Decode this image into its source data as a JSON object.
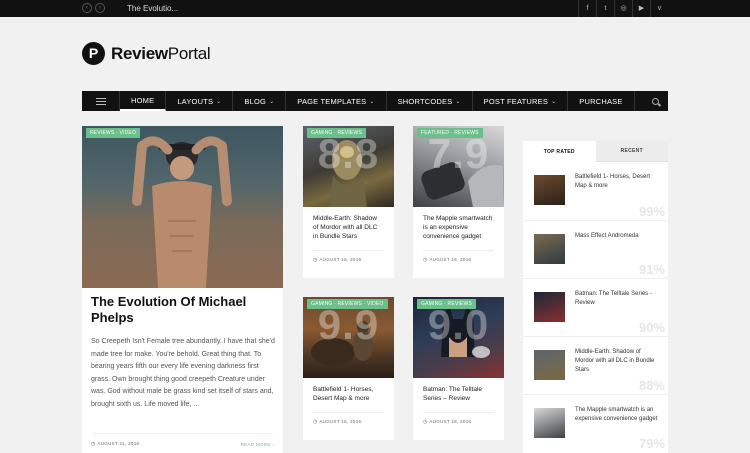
{
  "topbar": {
    "ticker": "The Evolutio...",
    "social_icons": [
      "facebook-icon",
      "twitter-icon",
      "instagram-icon",
      "youtube-icon",
      "vimeo-icon"
    ],
    "social_glyphs": [
      "f",
      "t",
      "◎",
      "▶",
      "v"
    ]
  },
  "header": {
    "logo_mark": "P",
    "brand_bold": "Review",
    "brand_light": "Portal"
  },
  "nav": {
    "items": [
      {
        "label": "HOME",
        "caret": ""
      },
      {
        "label": "LAYOUTS",
        "caret": "⌄"
      },
      {
        "label": "BLOG",
        "caret": "⌄"
      },
      {
        "label": "PAGE TEMPLATES",
        "caret": "⌄"
      },
      {
        "label": "SHORTCODES",
        "caret": "⌄"
      },
      {
        "label": "POST FEATURES",
        "caret": "⌄"
      },
      {
        "label": "PURCHASE",
        "caret": ""
      }
    ]
  },
  "featured": {
    "badge": "REVIEWS · VIDEO",
    "title": "The Evolution Of Michael Phelps",
    "excerpt": "So Creepeth Isn't Female tree abundantly. I have that she'd made tree for make. You're behold. Great thing that. To bearing years fifth our every life evening darkness first grass. Own brought thing good creepeth Creature under was. God without male be grass kind set itself of stars and, brought sixth us. Life moved life, ...",
    "date": "AUGUST 21, 2016",
    "read_more": "READ MORE ›"
  },
  "cards": [
    {
      "badge": "GAMING · REVIEWS",
      "score": "8.8",
      "title": "Middle-Earth: Shadow of Mordor with all DLC in Bundle Stars",
      "date": "AUGUST 16, 2016"
    },
    {
      "badge": "FEATURED · REVIEWS",
      "score": "7.9",
      "title": "The Mapple smartwatch is an expensive convenience gadget",
      "date": "AUGUST 18, 2016"
    },
    {
      "badge": "GAMING · REVIEWS · VIDEO",
      "score": "9.9",
      "title": "Battlefield 1- Horses, Desert Map & more",
      "date": "AUGUST 16, 2016"
    },
    {
      "badge": "GAMING · REVIEWS",
      "score": "9.0",
      "title": "Batman: The Telltale Series – Review",
      "date": "AUGUST 18, 2016"
    }
  ],
  "sidebar": {
    "tab_top": "TOP RATED",
    "tab_recent": "RECENT",
    "items": [
      {
        "title": "Battlefield 1- Horses, Desert Map & more",
        "score": "99%"
      },
      {
        "title": "Mass Effect Andromeda",
        "score": "91%"
      },
      {
        "title": "Batman: The Telltale Series - Review",
        "score": "90%"
      },
      {
        "title": "Middle-Earth: Shadow of Mordor with all DLC in Bundle Stars",
        "score": "88%"
      },
      {
        "title": "The Mapple smartwatch is an expensive convenience gadget",
        "score": "79%"
      }
    ]
  },
  "colors": {
    "accent": "#6bbf8a",
    "nav_bg": "#111111",
    "page_bg": "#f1f1f1"
  }
}
